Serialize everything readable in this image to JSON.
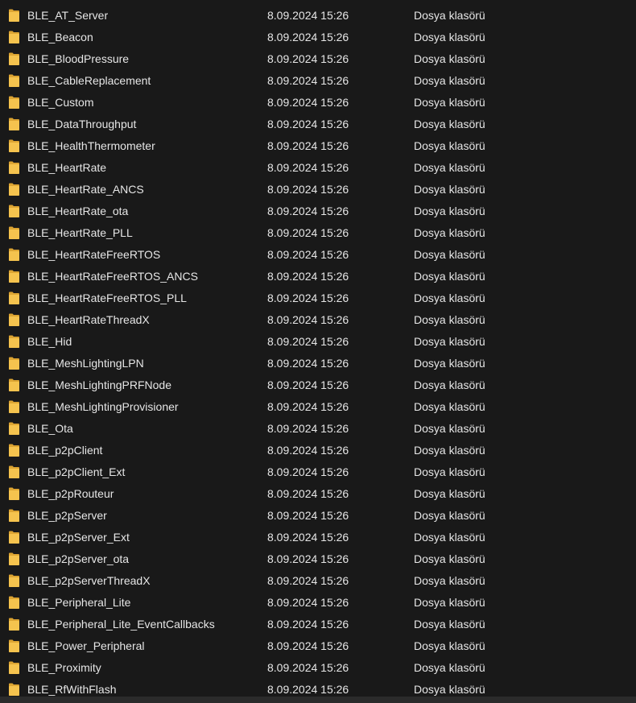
{
  "colors": {
    "background": "#191919",
    "text": "#e6e6e6",
    "folder": "#f5c34e",
    "folder_dark": "#dca432"
  },
  "icons": {
    "folder": "folder-icon"
  },
  "files": [
    {
      "name": "BLE_AT_Server",
      "date": "8.09.2024 15:26",
      "type": "Dosya klasörü"
    },
    {
      "name": "BLE_Beacon",
      "date": "8.09.2024 15:26",
      "type": "Dosya klasörü"
    },
    {
      "name": "BLE_BloodPressure",
      "date": "8.09.2024 15:26",
      "type": "Dosya klasörü"
    },
    {
      "name": "BLE_CableReplacement",
      "date": "8.09.2024 15:26",
      "type": "Dosya klasörü"
    },
    {
      "name": "BLE_Custom",
      "date": "8.09.2024 15:26",
      "type": "Dosya klasörü"
    },
    {
      "name": "BLE_DataThroughput",
      "date": "8.09.2024 15:26",
      "type": "Dosya klasörü"
    },
    {
      "name": "BLE_HealthThermometer",
      "date": "8.09.2024 15:26",
      "type": "Dosya klasörü"
    },
    {
      "name": "BLE_HeartRate",
      "date": "8.09.2024 15:26",
      "type": "Dosya klasörü"
    },
    {
      "name": "BLE_HeartRate_ANCS",
      "date": "8.09.2024 15:26",
      "type": "Dosya klasörü"
    },
    {
      "name": "BLE_HeartRate_ota",
      "date": "8.09.2024 15:26",
      "type": "Dosya klasörü"
    },
    {
      "name": "BLE_HeartRate_PLL",
      "date": "8.09.2024 15:26",
      "type": "Dosya klasörü"
    },
    {
      "name": "BLE_HeartRateFreeRTOS",
      "date": "8.09.2024 15:26",
      "type": "Dosya klasörü"
    },
    {
      "name": "BLE_HeartRateFreeRTOS_ANCS",
      "date": "8.09.2024 15:26",
      "type": "Dosya klasörü"
    },
    {
      "name": "BLE_HeartRateFreeRTOS_PLL",
      "date": "8.09.2024 15:26",
      "type": "Dosya klasörü"
    },
    {
      "name": "BLE_HeartRateThreadX",
      "date": "8.09.2024 15:26",
      "type": "Dosya klasörü"
    },
    {
      "name": "BLE_Hid",
      "date": "8.09.2024 15:26",
      "type": "Dosya klasörü"
    },
    {
      "name": "BLE_MeshLightingLPN",
      "date": "8.09.2024 15:26",
      "type": "Dosya klasörü"
    },
    {
      "name": "BLE_MeshLightingPRFNode",
      "date": "8.09.2024 15:26",
      "type": "Dosya klasörü"
    },
    {
      "name": "BLE_MeshLightingProvisioner",
      "date": "8.09.2024 15:26",
      "type": "Dosya klasörü"
    },
    {
      "name": "BLE_Ota",
      "date": "8.09.2024 15:26",
      "type": "Dosya klasörü"
    },
    {
      "name": "BLE_p2pClient",
      "date": "8.09.2024 15:26",
      "type": "Dosya klasörü"
    },
    {
      "name": "BLE_p2pClient_Ext",
      "date": "8.09.2024 15:26",
      "type": "Dosya klasörü"
    },
    {
      "name": "BLE_p2pRouteur",
      "date": "8.09.2024 15:26",
      "type": "Dosya klasörü"
    },
    {
      "name": "BLE_p2pServer",
      "date": "8.09.2024 15:26",
      "type": "Dosya klasörü"
    },
    {
      "name": "BLE_p2pServer_Ext",
      "date": "8.09.2024 15:26",
      "type": "Dosya klasörü"
    },
    {
      "name": "BLE_p2pServer_ota",
      "date": "8.09.2024 15:26",
      "type": "Dosya klasörü"
    },
    {
      "name": "BLE_p2pServerThreadX",
      "date": "8.09.2024 15:26",
      "type": "Dosya klasörü"
    },
    {
      "name": "BLE_Peripheral_Lite",
      "date": "8.09.2024 15:26",
      "type": "Dosya klasörü"
    },
    {
      "name": "BLE_Peripheral_Lite_EventCallbacks",
      "date": "8.09.2024 15:26",
      "type": "Dosya klasörü"
    },
    {
      "name": "BLE_Power_Peripheral",
      "date": "8.09.2024 15:26",
      "type": "Dosya klasörü"
    },
    {
      "name": "BLE_Proximity",
      "date": "8.09.2024 15:26",
      "type": "Dosya klasörü"
    },
    {
      "name": "BLE_RfWithFlash",
      "date": "8.09.2024 15:26",
      "type": "Dosya klasörü"
    }
  ]
}
